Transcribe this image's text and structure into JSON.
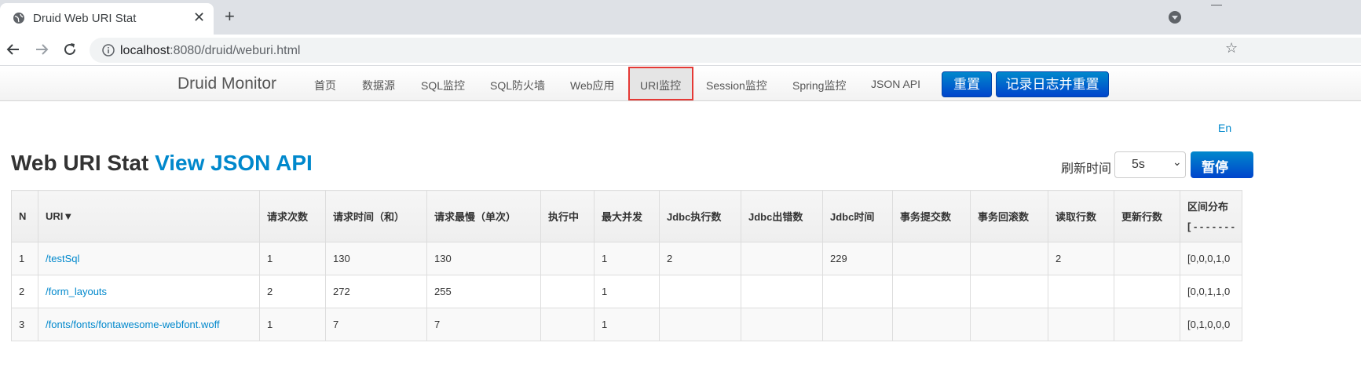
{
  "browser": {
    "tab_title": "Druid Web URI Stat",
    "tab_close": "✕",
    "new_tab": "+",
    "url_host": "localhost",
    "url_rest": ":8080/druid/weburi.html",
    "icons": [
      "globe-icon",
      "close-icon",
      "plus-icon",
      "back-icon",
      "forward-icon",
      "reload-icon",
      "info-icon",
      "star-icon"
    ]
  },
  "nav": {
    "brand": "Druid Monitor",
    "items": [
      "首页",
      "数据源",
      "SQL监控",
      "SQL防火墙",
      "Web应用",
      "URI监控",
      "Session监控",
      "Spring监控",
      "JSON API"
    ],
    "active": "URI监控",
    "reset_label": "重置",
    "log_reset_label": "记录日志并重置",
    "accent": "#0088cc",
    "highlight_border": "#e53935"
  },
  "lang_link": "En",
  "heading": {
    "title": "Web URI Stat",
    "link": "View JSON API"
  },
  "refresh": {
    "label": "刷新时间",
    "value": "5s",
    "pause_label": "暂停"
  },
  "table": {
    "headers": [
      "N",
      "URI▼",
      "请求次数",
      "请求时间（和）",
      "请求最慢（单次）",
      "执行中",
      "最大并发",
      "Jdbc执行数",
      "Jdbc出错数",
      "Jdbc时间",
      "事务提交数",
      "事务回滚数",
      "读取行数",
      "更新行数"
    ],
    "last_header": [
      "区间分布",
      "[ - - - - - - -"
    ],
    "rows": [
      [
        "1",
        "/testSql",
        "1",
        "130",
        "130",
        "",
        "1",
        "2",
        "",
        "229",
        "",
        "",
        "2",
        "",
        "[0,0,0,1,0"
      ],
      [
        "2",
        "/form_layouts",
        "2",
        "272",
        "255",
        "",
        "1",
        "",
        "",
        "",
        "",
        "",
        "",
        "",
        "[0,0,1,1,0"
      ],
      [
        "3",
        "/fonts/fonts/fontawesome-webfont.woff",
        "1",
        "7",
        "7",
        "",
        "1",
        "",
        "",
        "",
        "",
        "",
        "",
        "",
        "[0,1,0,0,0"
      ]
    ]
  }
}
